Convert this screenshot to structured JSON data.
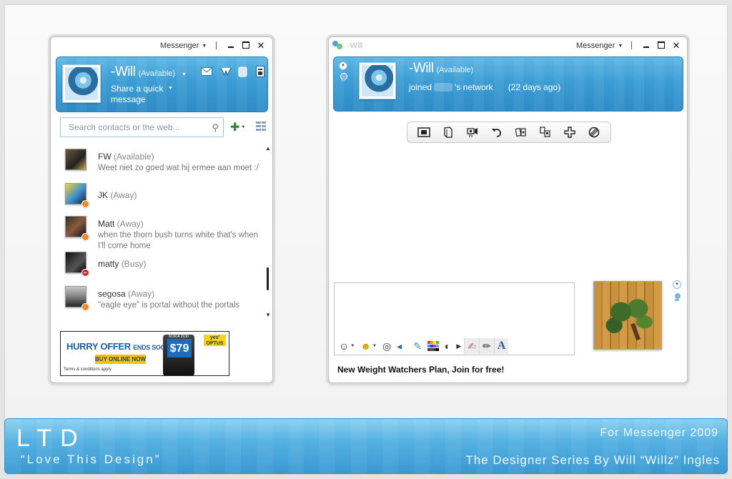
{
  "left_window": {
    "menu_label": "Messenger",
    "user_name": "-Will",
    "user_status": "(Available)",
    "personal_message": "Share a quick message",
    "search_placeholder": "Search contacts or the web...",
    "contacts": [
      {
        "name": "FW",
        "status": "(Available)",
        "message": "Weet niet zo goed wat hij ermee aan moet :/"
      },
      {
        "name": "JK",
        "status": "(Away)",
        "message": ""
      },
      {
        "name": "Matt",
        "status": "(Away)",
        "message": "when the thorn bush turns white that's when I'll come home"
      },
      {
        "name": "matty",
        "status": "(Busy)",
        "message": ""
      },
      {
        "name": "segosa",
        "status": "(Away)",
        "message": "\"eagle eye\" is portal without the portals"
      }
    ],
    "ad": {
      "headline": "HURRY OFFER",
      "headline_small": "ENDS SOON.",
      "button": "BUY ONLINE NOW",
      "terms": "Terms & conditions apply",
      "phone_label": "NOKIA 2630",
      "price": "$79",
      "brand": "yes' OPTUS"
    }
  },
  "right_window": {
    "menu_label": "Messenger",
    "title_name": "-Will",
    "contact_name": "-Will",
    "contact_status": "(Available)",
    "joined_prefix": "joined",
    "joined_suffix": "'s network",
    "joined_days": "(22 days ago)",
    "ad_text": "New Weight Watchers Plan, Join for free!"
  },
  "footer": {
    "logo": "LTD",
    "tagline": "“Love This Design”",
    "for_messenger": "For Messenger 2009",
    "designer_series": "The Designer Series By Will “Willz” Ingles"
  },
  "colors": {
    "accent_blue": "#3b9dd4",
    "away": "#f08a24",
    "busy": "#d8262b"
  },
  "icons": {
    "header_left": [
      "mail-icon",
      "favorites-icon",
      "contact-card-icon",
      "menu-icon"
    ],
    "toolbar": [
      "photo-share-icon",
      "file-send-icon",
      "video-call-icon",
      "undo-icon",
      "games-icon",
      "activities-icon",
      "add-contact-icon",
      "block-icon"
    ],
    "compose": [
      "emoticon-icon",
      "wink-icon",
      "nudge-icon",
      "voice-clip-icon",
      "ink-icon",
      "palette-icon",
      "sound-icon",
      "more-arrow-icon",
      "handwriting-icon",
      "pen-icon",
      "font-icon"
    ]
  }
}
